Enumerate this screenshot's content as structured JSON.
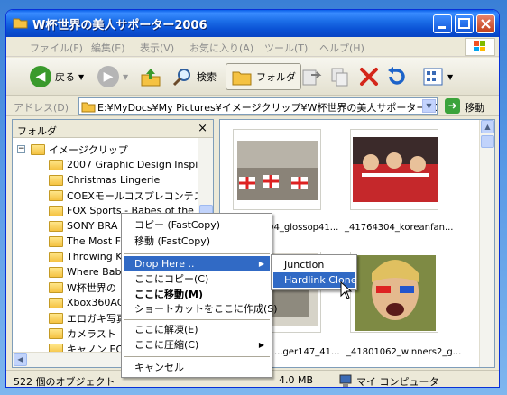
{
  "window": {
    "title": "W杯世界の美人サポーター2006",
    "title_color": "#ffffff",
    "titlebar_color": "#0b53d6"
  },
  "menu": [
    "ファイル(F)",
    "編集(E)",
    "表示(V)",
    "お気に入り(A)",
    "ツール(T)",
    "ヘルプ(H)"
  ],
  "toolbar": {
    "back_label": "戻る",
    "search_label": "検索",
    "folder_label": "フォルダ"
  },
  "address": {
    "label": "アドレス(D)",
    "value": "E:¥MyDocs¥My Pictures¥イメージクリップ¥W杯世界の美人サポーター2006",
    "go_label": "移動"
  },
  "folder_pane": {
    "title": "フォルダ",
    "close_glyph": "×",
    "root": "イメージクリップ",
    "items": [
      "2007 Graphic Design Inspirat",
      "Christmas Lingerie",
      "COEXモールコスプレコンテスト",
      "FOX Sports - Babes of the W",
      "SONY BRA",
      "The Most F",
      "Throwing K",
      "Where Babi",
      "W杯世界の",
      "Xbox360AC",
      "エロガキ写真",
      "カメラスト",
      "キャノン EOS"
    ]
  },
  "files": [
    {
      "name": "_41749404_glossop41..."
    },
    {
      "name": "_41764304_koreanfan..."
    },
    {
      "name": "...ger147_41..."
    },
    {
      "name": "_41801062_winners2_g..."
    }
  ],
  "status": {
    "count": "522 個のオブジェクト",
    "size": "4.0 MB",
    "location": "マイ コンピュータ"
  },
  "context_menu": {
    "items": [
      "コピー (FastCopy)",
      "移動 (FastCopy)",
      "Drop Here ..",
      "ここにコピー(C)",
      "ここに移動(M)",
      "ショートカットをここに作成(S)",
      "ここに解凍(E)",
      "ここに圧縮(C)",
      "キャンセル"
    ],
    "highlight_color": "#316ac5"
  },
  "submenu": {
    "items": [
      "Junction",
      "Hardlink Clone"
    ]
  },
  "icons": [
    "folder-icon",
    "back-icon",
    "forward-icon",
    "up-icon",
    "search-icon",
    "folder-view-icon",
    "move-to-icon",
    "copy-to-icon",
    "delete-icon",
    "undo-icon",
    "views-icon",
    "go-icon",
    "my-computer-icon",
    "windows-logo-icon"
  ]
}
